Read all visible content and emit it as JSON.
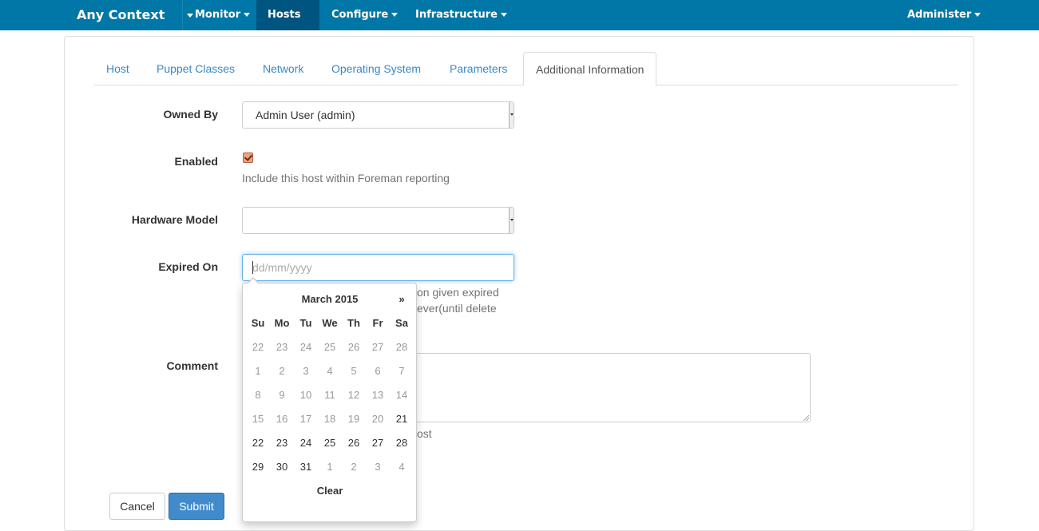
{
  "navbar": {
    "brand": "Any Context",
    "items": [
      {
        "label": "Monitor"
      },
      {
        "label": "Hosts"
      },
      {
        "label": "Configure"
      },
      {
        "label": "Infrastructure"
      }
    ],
    "right_item": "Administer",
    "active_item": "Hosts"
  },
  "tabs": [
    {
      "label": "Host"
    },
    {
      "label": "Puppet Classes"
    },
    {
      "label": "Network"
    },
    {
      "label": "Operating System"
    },
    {
      "label": "Parameters"
    },
    {
      "label": "Additional Information"
    }
  ],
  "active_tab": "Additional Information",
  "form": {
    "owned_by": {
      "label": "Owned By",
      "value": "Admin User (admin)"
    },
    "enabled": {
      "label": "Enabled",
      "checked": true,
      "help": "Include this host within Foreman reporting"
    },
    "hardware_model": {
      "label": "Hardware Model",
      "value": ""
    },
    "expired_on": {
      "label": "Expired On",
      "placeholder": "dd/mm/yyyy",
      "help_line1": "on given expired",
      "help_line2": "ever(until delete"
    },
    "comment": {
      "label": "Comment",
      "help": "ost"
    }
  },
  "buttons": {
    "cancel": "Cancel",
    "submit": "Submit"
  },
  "datepicker": {
    "title": "March 2015",
    "next": "»",
    "dow": [
      "Su",
      "Mo",
      "Tu",
      "We",
      "Th",
      "Fr",
      "Sa"
    ],
    "weeks": [
      [
        {
          "d": "22",
          "m": true
        },
        {
          "d": "23",
          "m": true
        },
        {
          "d": "24",
          "m": true
        },
        {
          "d": "25",
          "m": true
        },
        {
          "d": "26",
          "m": true
        },
        {
          "d": "27",
          "m": true
        },
        {
          "d": "28",
          "m": true
        }
      ],
      [
        {
          "d": "1",
          "m": true
        },
        {
          "d": "2",
          "m": true
        },
        {
          "d": "3",
          "m": true
        },
        {
          "d": "4",
          "m": true
        },
        {
          "d": "5",
          "m": true
        },
        {
          "d": "6",
          "m": true
        },
        {
          "d": "7",
          "m": true
        }
      ],
      [
        {
          "d": "8",
          "m": true
        },
        {
          "d": "9",
          "m": true
        },
        {
          "d": "10",
          "m": true
        },
        {
          "d": "11",
          "m": true
        },
        {
          "d": "12",
          "m": true
        },
        {
          "d": "13",
          "m": true
        },
        {
          "d": "14",
          "m": true
        }
      ],
      [
        {
          "d": "15",
          "m": true
        },
        {
          "d": "16",
          "m": true
        },
        {
          "d": "17",
          "m": true
        },
        {
          "d": "18",
          "m": true
        },
        {
          "d": "19",
          "m": true
        },
        {
          "d": "20",
          "m": true
        },
        {
          "d": "21",
          "m": false
        }
      ],
      [
        {
          "d": "22",
          "m": false
        },
        {
          "d": "23",
          "m": false
        },
        {
          "d": "24",
          "m": false
        },
        {
          "d": "25",
          "m": false
        },
        {
          "d": "26",
          "m": false
        },
        {
          "d": "27",
          "m": false
        },
        {
          "d": "28",
          "m": false
        }
      ],
      [
        {
          "d": "29",
          "m": false
        },
        {
          "d": "30",
          "m": false
        },
        {
          "d": "31",
          "m": false
        },
        {
          "d": "1",
          "m": true
        },
        {
          "d": "2",
          "m": true
        },
        {
          "d": "3",
          "m": true
        },
        {
          "d": "4",
          "m": true
        }
      ]
    ],
    "clear": "Clear"
  }
}
